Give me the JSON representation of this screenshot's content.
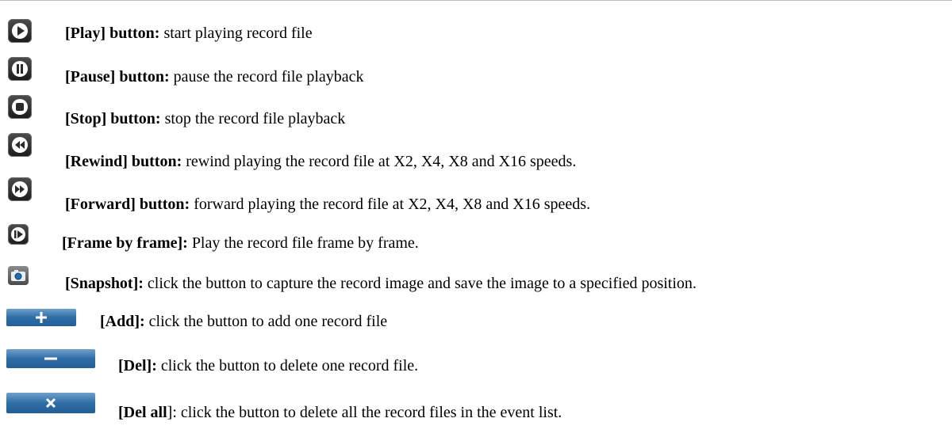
{
  "items": [
    {
      "icon": "play-icon",
      "label": "[Play] button:",
      "desc": " start playing record file"
    },
    {
      "icon": "pause-icon",
      "label": "[Pause] button:",
      "desc": " pause the record file playback"
    },
    {
      "icon": "stop-icon",
      "label": "[Stop] button:",
      "desc": " stop the record file playback"
    },
    {
      "icon": "rewind-icon",
      "label": "[Rewind] button:",
      "desc": " rewind playing the record file at X2, X4, X8 and X16 speeds."
    },
    {
      "icon": "forward-icon",
      "label": "[Forward] button:",
      "desc": " forward playing the record file at X2, X4, X8 and X16 speeds."
    },
    {
      "icon": "frame-step-icon",
      "label": "[Frame by frame]:",
      "desc": " Play the record file frame by frame."
    },
    {
      "icon": "camera-icon",
      "label": "[Snapshot]:",
      "desc": " click the button to capture the record image and save the image to a specified position."
    },
    {
      "icon": "plus-icon",
      "label": "[Add]:",
      "desc": " click the button to add one record file"
    },
    {
      "icon": "minus-icon",
      "label": "[Del]:",
      "desc": " click the button to delete one record file."
    },
    {
      "icon": "x-icon",
      "label": "[Del all",
      "label_tail": "]",
      "desc": ": click the button to delete all the record files in the event list."
    }
  ]
}
